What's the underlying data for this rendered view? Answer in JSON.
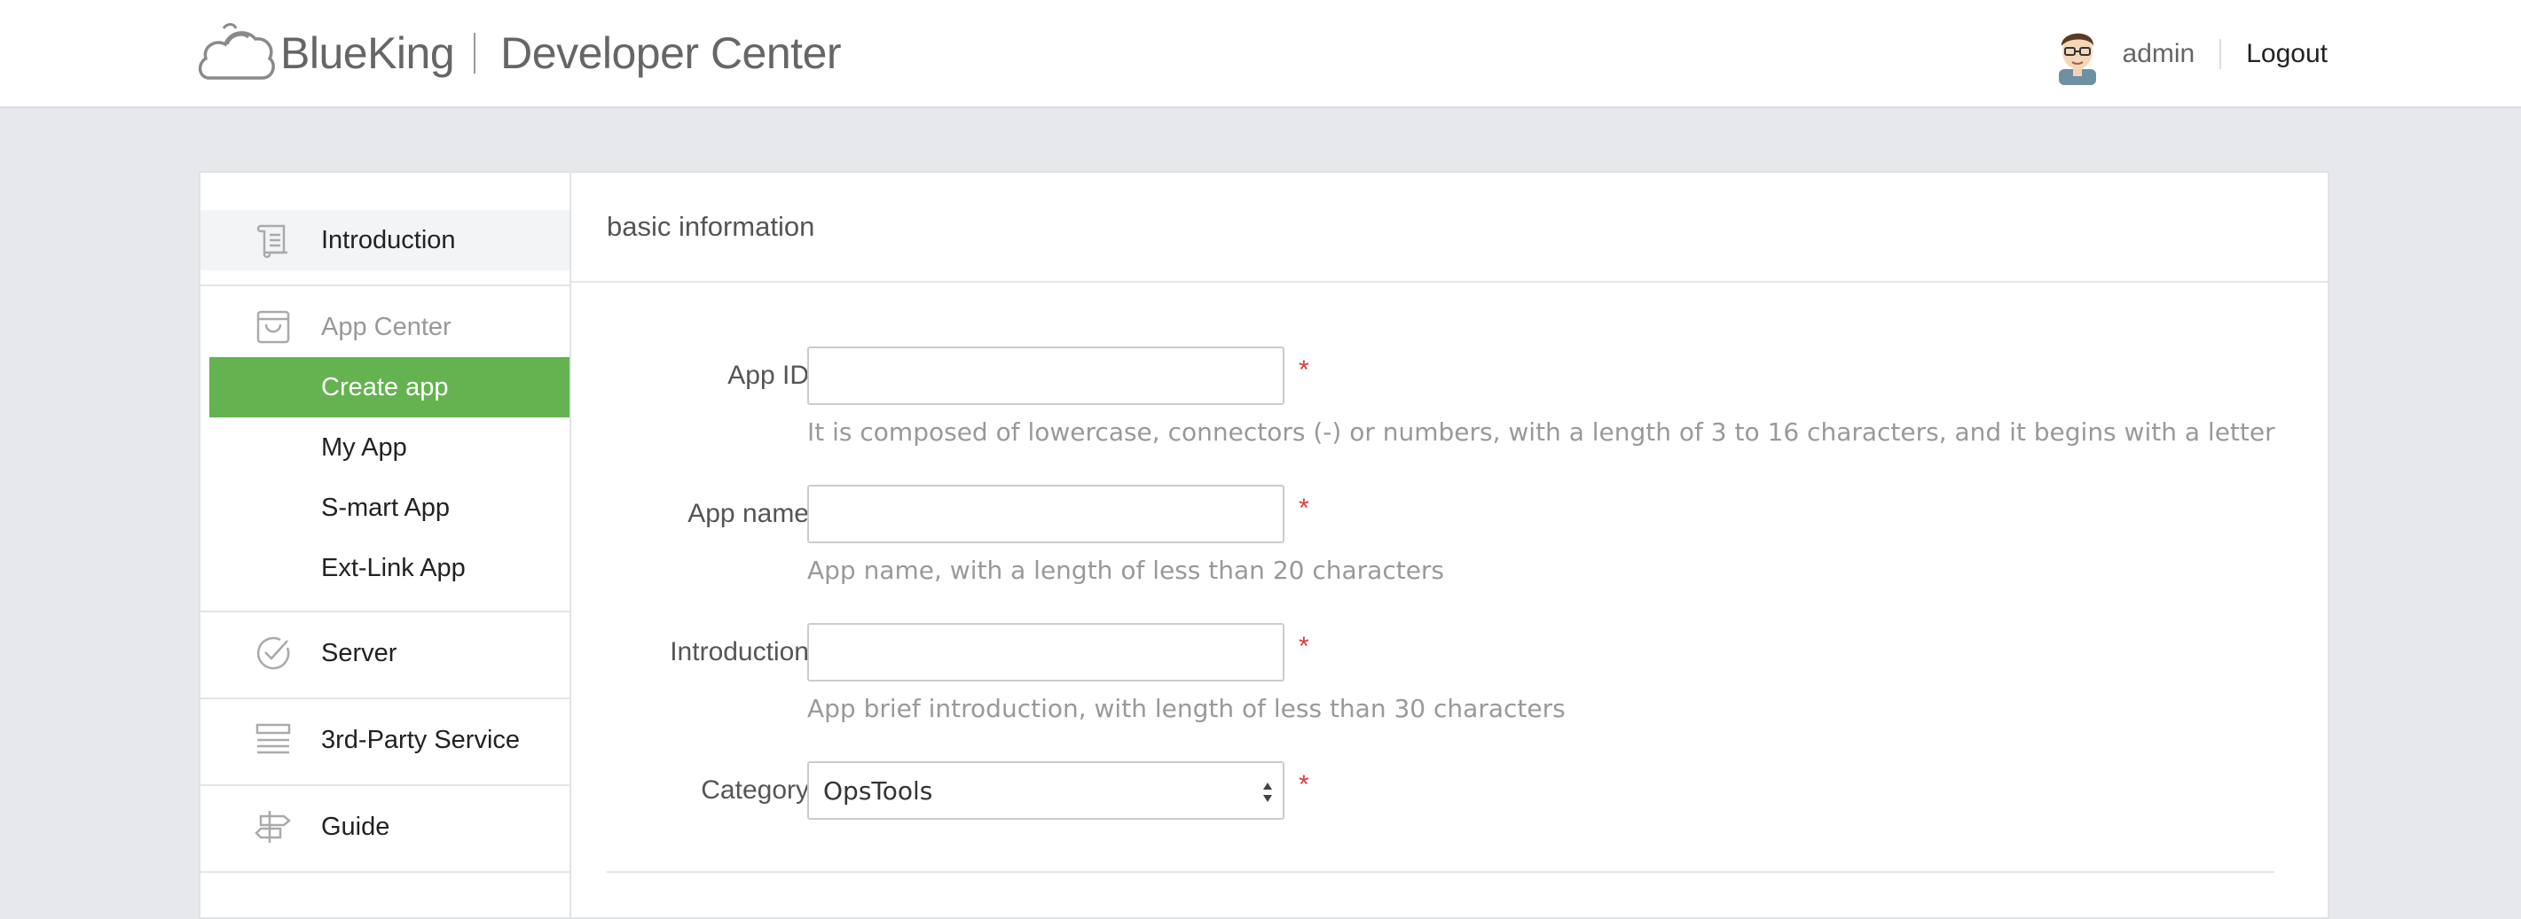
{
  "header": {
    "brand_name": "BlueKing",
    "title": "Developer Center",
    "username": "admin",
    "logout_label": "Logout"
  },
  "sidebar": {
    "introduction": "Introduction",
    "app_center": {
      "label": "App Center",
      "items": [
        "Create app",
        "My App",
        "S-mart App",
        "Ext-Link App"
      ]
    },
    "server": "Server",
    "third_party": "3rd-Party Service",
    "guide": "Guide"
  },
  "form": {
    "section_title": "basic information",
    "app_id": {
      "label": "App ID",
      "value": "",
      "hint": "It is composed of lowercase, connectors (-) or numbers, with a length of 3 to 16 characters, and it begins with a letter"
    },
    "app_name": {
      "label": "App name",
      "value": "",
      "hint": "App name, with a length of less than 20 characters"
    },
    "introduction": {
      "label": "Introduction",
      "value": "",
      "hint": "App brief introduction, with length of less than 30 characters"
    },
    "category": {
      "label": "Category",
      "selected": "OpsTools"
    },
    "required_mark": "*"
  },
  "colors": {
    "accent": "#64b350",
    "required": "#e0383e",
    "page_bg": "#e6e8ec"
  },
  "icons": [
    "blueking-cloud-logo",
    "avatar",
    "scroll-icon",
    "shopping-bag-icon",
    "check-circle-icon",
    "server-list-icon",
    "signpost-icon",
    "select-arrows-icon"
  ]
}
